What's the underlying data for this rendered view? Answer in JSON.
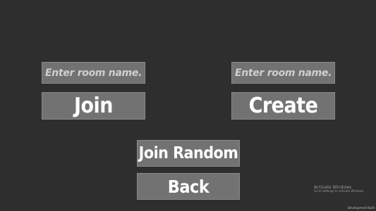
{
  "left_panel": {
    "room_input_placeholder": "Enter room name...",
    "join_label": "Join"
  },
  "right_panel": {
    "room_input_placeholder": "Enter room name...",
    "create_label": "Create"
  },
  "center_panel": {
    "join_random_label": "Join Random",
    "back_label": "Back"
  },
  "watermark": {
    "title": "Activate Windows",
    "subtitle": "Go to Settings to activate Windows."
  },
  "build_label": "Development Build",
  "colors": {
    "background": "#2e2e2e",
    "button_fill": "#727272",
    "button_text": "#ffffff",
    "placeholder_text": "#cfcfcf"
  }
}
